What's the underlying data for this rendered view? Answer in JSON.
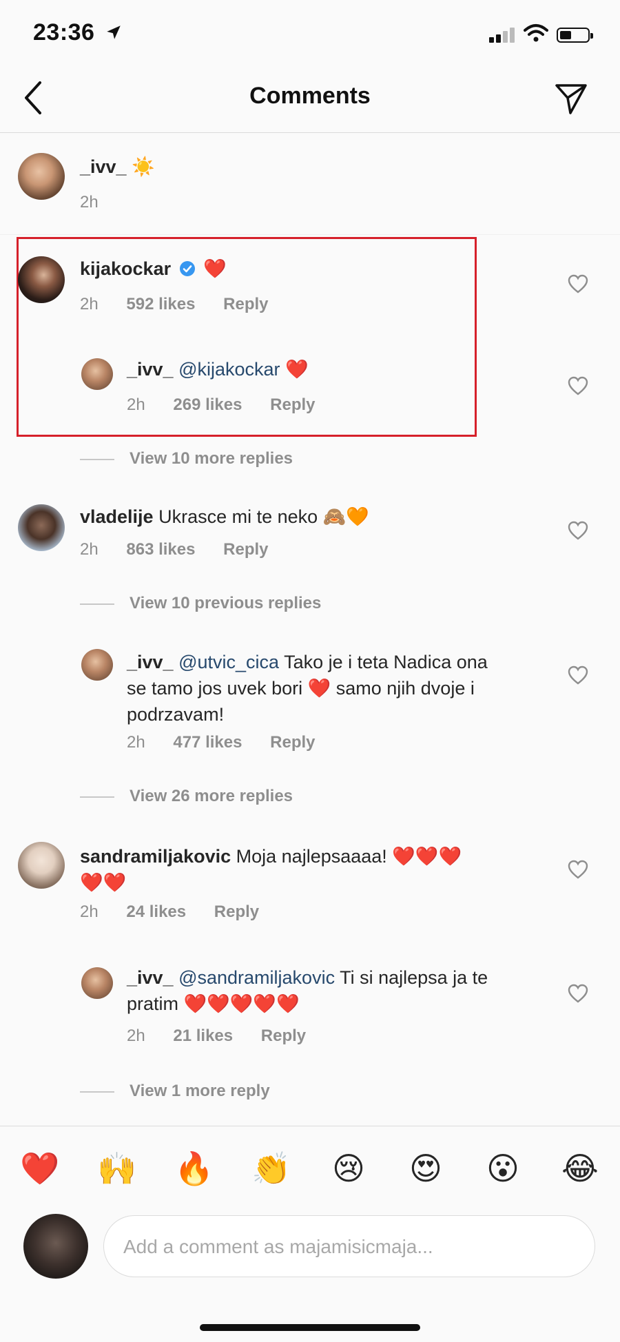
{
  "status_bar": {
    "time": "23:36"
  },
  "header": {
    "title": "Comments"
  },
  "caption": {
    "username": "_ivv_",
    "emoji": "☀️",
    "time": "2h"
  },
  "comments": [
    {
      "username": "kijakockar",
      "text": "❤️",
      "time": "2h",
      "likes": "592 likes",
      "reply": "Reply"
    },
    {
      "username": "_ivv_",
      "mention": "@kijakockar",
      "text": "❤️",
      "time": "2h",
      "likes": "269 likes",
      "reply": "Reply"
    },
    {
      "username": "vladelije",
      "text": "Ukrasce mi te neko 🙈🧡",
      "time": "2h",
      "likes": "863 likes",
      "reply": "Reply"
    },
    {
      "username": "_ivv_",
      "mention": "@utvic_cica",
      "line1": "Tako je i teta Nadica ona",
      "line2": "se tamo jos uvek bori ❤️ samo njih dvoje i",
      "line3": "podrzavam!",
      "time": "2h",
      "likes": "477 likes",
      "reply": "Reply"
    },
    {
      "username": "sandramiljakovic",
      "line1": "Moja najlepsaaaa! ❤️❤️❤️",
      "line2": "❤️❤️",
      "time": "2h",
      "likes": "24 likes",
      "reply": "Reply"
    },
    {
      "username": "_ivv_",
      "mention": "@sandramiljakovic",
      "line1": "Ti si najlepsa ja te",
      "line2": "pratim ❤️❤️❤️❤️❤️",
      "time": "2h",
      "likes": "21 likes",
      "reply": "Reply"
    }
  ],
  "view_more": [
    "View 10 more replies",
    "View 10 previous replies",
    "View 26 more replies",
    "View 1 more reply"
  ],
  "quick_reactions": [
    "❤️",
    "🙌",
    "🔥",
    "👏",
    "😢",
    "😍",
    "😮",
    "😂"
  ],
  "input": {
    "placeholder": "Add a comment as majamisicmaja..."
  }
}
